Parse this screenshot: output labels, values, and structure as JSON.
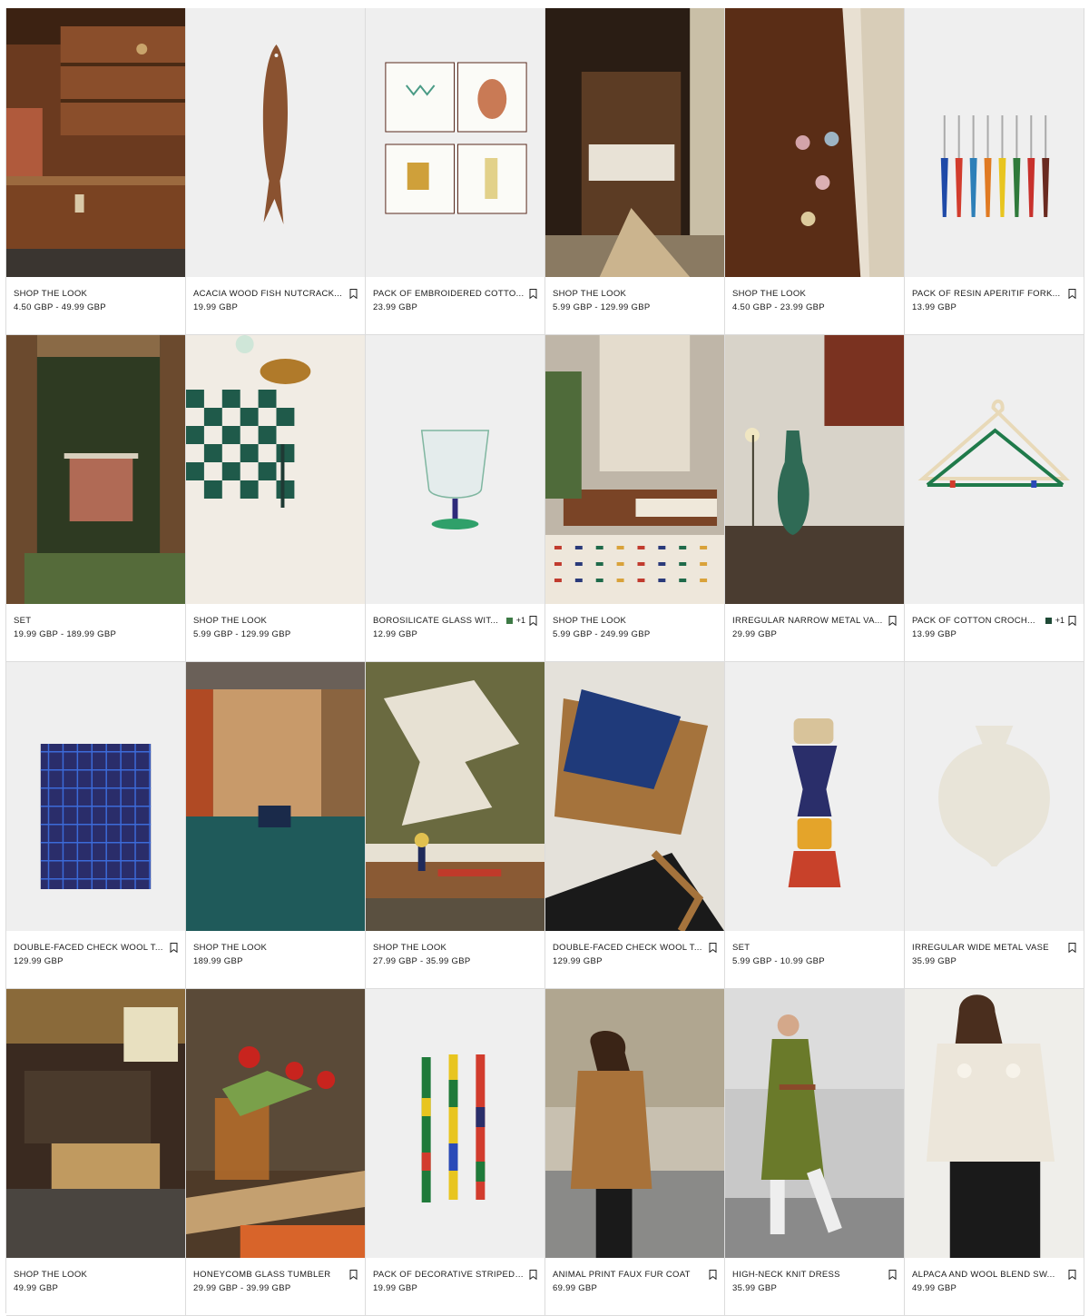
{
  "products": [
    {
      "title": "SHOP THE LOOK",
      "price": "4.50 GBP - 49.99 GBP",
      "image_icon": "wooden-kitchen-interior-image",
      "bookmark": false
    },
    {
      "title": "ACACIA WOOD FISH NUTCRACK...",
      "price": "19.99 GBP",
      "image_icon": "wooden-fish-nutcracker-image",
      "bookmark": true
    },
    {
      "title": "PACK OF EMBROIDERED COTTO...",
      "price": "23.99 GBP",
      "image_icon": "embroidered-napkins-image",
      "bookmark": true
    },
    {
      "title": "SHOP THE LOOK",
      "price": "5.99 GBP - 129.99 GBP",
      "image_icon": "doorway-dining-room-image",
      "bookmark": false
    },
    {
      "title": "SHOP THE LOOK",
      "price": "4.50 GBP - 23.99 GBP",
      "image_icon": "glasses-on-wood-table-image",
      "bookmark": false
    },
    {
      "title": "PACK OF RESIN APERITIF FORK...",
      "price": "13.99 GBP",
      "image_icon": "aperitif-forks-image",
      "bookmark": true
    },
    {
      "title": "SET",
      "price": "19.99 GBP - 189.99 GBP",
      "image_icon": "veranda-table-image",
      "bookmark": false
    },
    {
      "title": "SHOP THE LOOK",
      "price": "5.99 GBP - 129.99 GBP",
      "image_icon": "checkered-tablecloth-image",
      "bookmark": false
    },
    {
      "title": "BOROSILICATE GLASS WIT...",
      "price": "12.99 GBP",
      "image_icon": "wine-glass-image",
      "bookmark": true,
      "swatch": "#3d7a45",
      "more": "+1"
    },
    {
      "title": "SHOP THE LOOK",
      "price": "5.99 GBP - 249.99 GBP",
      "image_icon": "bedroom-rug-image",
      "bookmark": false
    },
    {
      "title": "IRREGULAR NARROW METAL VA...",
      "price": "29.99 GBP",
      "image_icon": "green-vase-image",
      "bookmark": true
    },
    {
      "title": "PACK OF COTTON CROCH...",
      "price": "13.99 GBP",
      "image_icon": "crochet-hangers-image",
      "bookmark": true,
      "swatch": "#1f4a36",
      "more": "+1"
    },
    {
      "title": "DOUBLE-FACED CHECK WOOL T...",
      "price": "129.99 GBP",
      "image_icon": "check-wool-throw-image",
      "bookmark": true
    },
    {
      "title": "SHOP THE LOOK",
      "price": "189.99 GBP",
      "image_icon": "bed-alcove-image",
      "bookmark": false
    },
    {
      "title": "SHOP THE LOOK",
      "price": "27.99 GBP - 35.99 GBP",
      "image_icon": "living-room-art-image",
      "bookmark": false
    },
    {
      "title": "DOUBLE-FACED CHECK WOOL T...",
      "price": "129.99 GBP",
      "image_icon": "chair-with-throw-image",
      "bookmark": true
    },
    {
      "title": "SET",
      "price": "5.99 GBP - 10.99 GBP",
      "image_icon": "stacked-candle-holders-image",
      "bookmark": false
    },
    {
      "title": "IRREGULAR WIDE METAL VASE",
      "price": "35.99 GBP",
      "image_icon": "white-vase-image",
      "bookmark": true
    },
    {
      "title": "SHOP THE LOOK",
      "price": "49.99 GBP",
      "image_icon": "lounge-sofa-image",
      "bookmark": false
    },
    {
      "title": "HONEYCOMB GLASS TUMBLER",
      "price": "29.99 GBP - 39.99 GBP",
      "image_icon": "flowers-in-tumbler-image",
      "bookmark": true
    },
    {
      "title": "PACK OF DECORATIVE STRIPED ...",
      "price": "19.99 GBP",
      "image_icon": "striped-candles-image",
      "bookmark": true
    },
    {
      "title": "ANIMAL PRINT FAUX FUR COAT",
      "price": "69.99 GBP",
      "image_icon": "faux-fur-coat-model-image",
      "bookmark": true
    },
    {
      "title": "HIGH-NECK KNIT DRESS",
      "price": "35.99 GBP",
      "image_icon": "knit-dress-model-image",
      "bookmark": true
    },
    {
      "title": "ALPACA AND WOOL BLEND SW...",
      "price": "49.99 GBP",
      "image_icon": "alpaca-sweater-model-image",
      "bookmark": true
    }
  ]
}
